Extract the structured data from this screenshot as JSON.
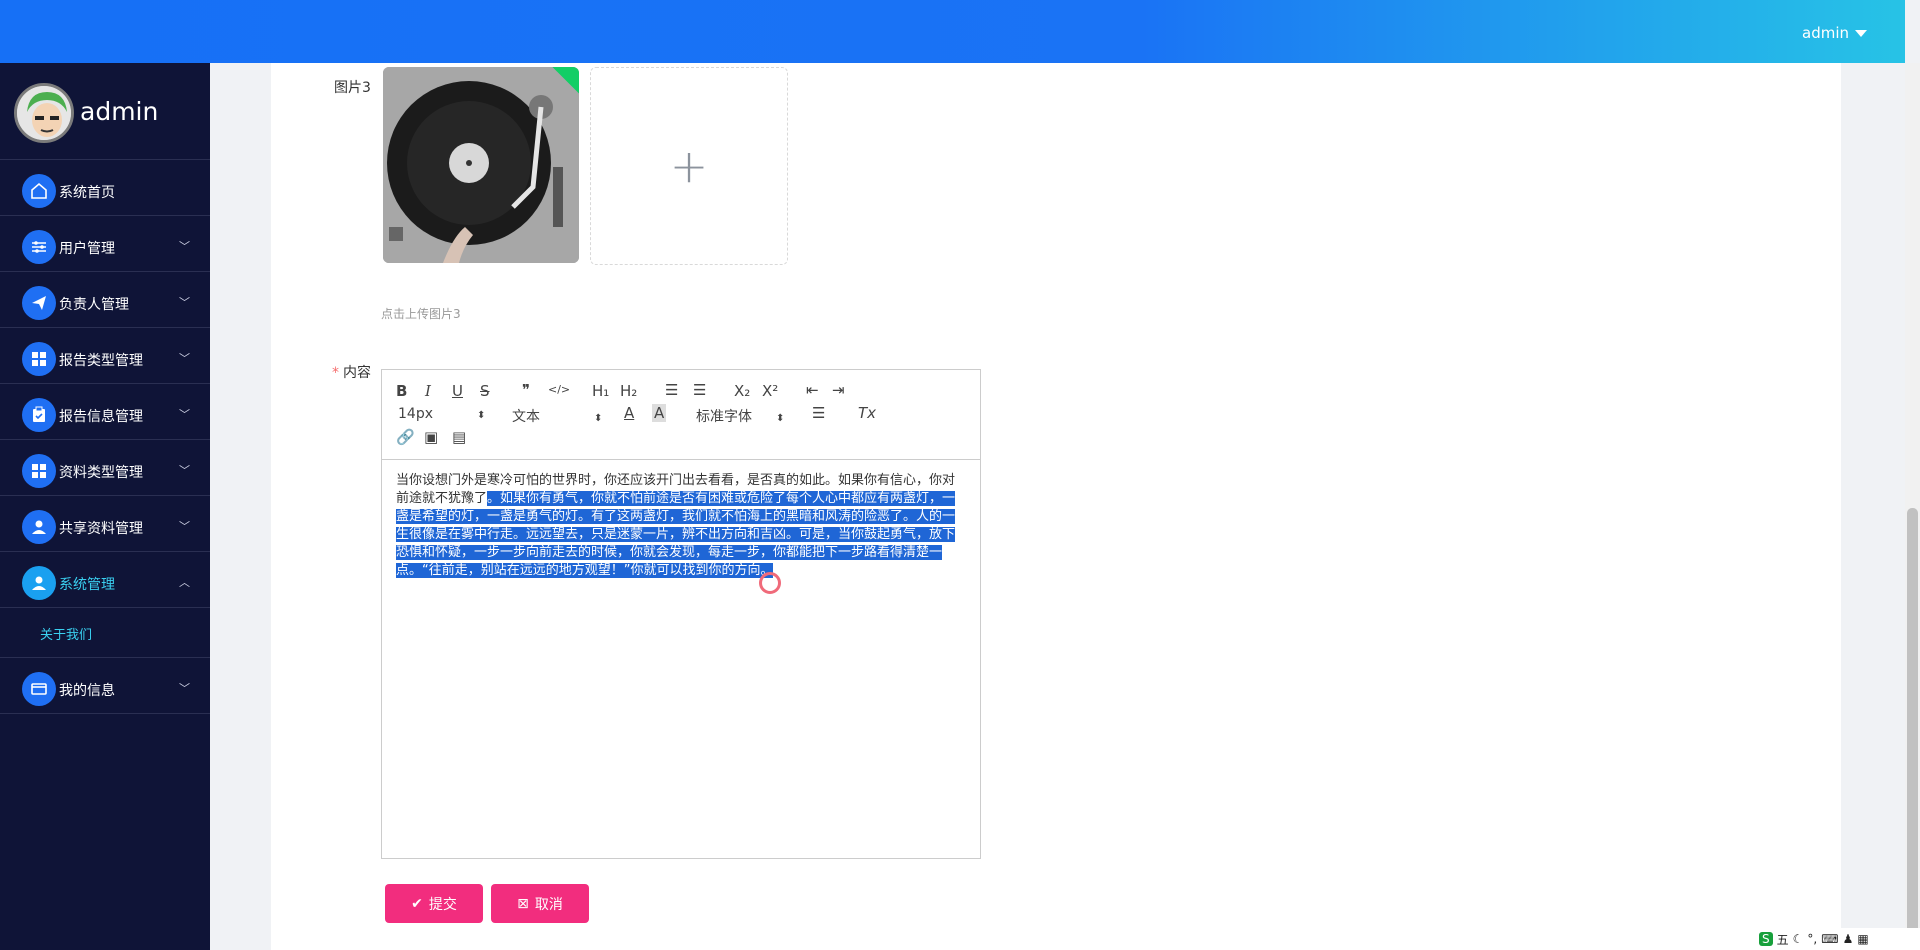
{
  "header": {
    "user": "admin"
  },
  "sidebar": {
    "profile_name": "admin",
    "items": [
      {
        "label": "系统首页",
        "icon": "home-icon",
        "expand": ""
      },
      {
        "label": "用户管理",
        "icon": "sliders-icon",
        "expand": "﹀"
      },
      {
        "label": "负责人管理",
        "icon": "send-icon",
        "expand": "﹀"
      },
      {
        "label": "报告类型管理",
        "icon": "grid-icon",
        "expand": "﹀"
      },
      {
        "label": "报告信息管理",
        "icon": "clipboard-icon",
        "expand": "﹀"
      },
      {
        "label": "资料类型管理",
        "icon": "grid-icon",
        "expand": "﹀"
      },
      {
        "label": "共享资料管理",
        "icon": "user-icon",
        "expand": "﹀"
      },
      {
        "label": "系统管理",
        "icon": "user-icon",
        "expand": "︿"
      },
      {
        "label": "我的信息",
        "icon": "card-icon",
        "expand": "﹀"
      }
    ],
    "sub_item": "关于我们"
  },
  "form": {
    "pic3_label": "图片3",
    "upload_plus": "+",
    "upload_tip": "点击上传图片3",
    "content_label": "内容",
    "required_mark": "*"
  },
  "editor": {
    "toolbar": {
      "bold": "B",
      "italic": "I",
      "underline": "U",
      "strike": "S",
      "quote": "❞",
      "code": "</>",
      "h1": "H₁",
      "h2": "H₂",
      "ol": "☰",
      "ul": "☰",
      "sub": "X₂",
      "sup": "X²",
      "outdent": "⇤",
      "indent": "⇥",
      "size": "14px",
      "format": "文本",
      "font": "标准字体",
      "clean": "Tx"
    },
    "text_normal": "当你设想门外是寒冷可怕的世界时，你还应该开门出去看看，是否真的如此。如果你有信心，你对前途就不犹豫了",
    "text_selected": "。如果你有勇气，你就不怕前途是否有困难或危险了每个人心中都应有两盏灯，一盏是希望的灯，一盏是勇气的灯。有了这两盏灯，我们就不怕海上的黑暗和风涛的险恶了。人的一生很像是在雾中行走。远远望去，只是迷蒙一片，辨不出方向和吉凶。可是，当你鼓起勇气，放下恐惧和怀疑，一步一步向前走去的时候，你就会发现，每走一步，你都能把下一步路看得清楚一点。“往前走，别站在远远的地方观望！”你就可以找到你的方向。"
  },
  "buttons": {
    "submit": "提交",
    "cancel": "取消"
  },
  "tray": {
    "ime": "五"
  },
  "colors": {
    "accent": "#1f6ff3",
    "button": "#f22d7e",
    "sidebar": "#0f1437"
  }
}
